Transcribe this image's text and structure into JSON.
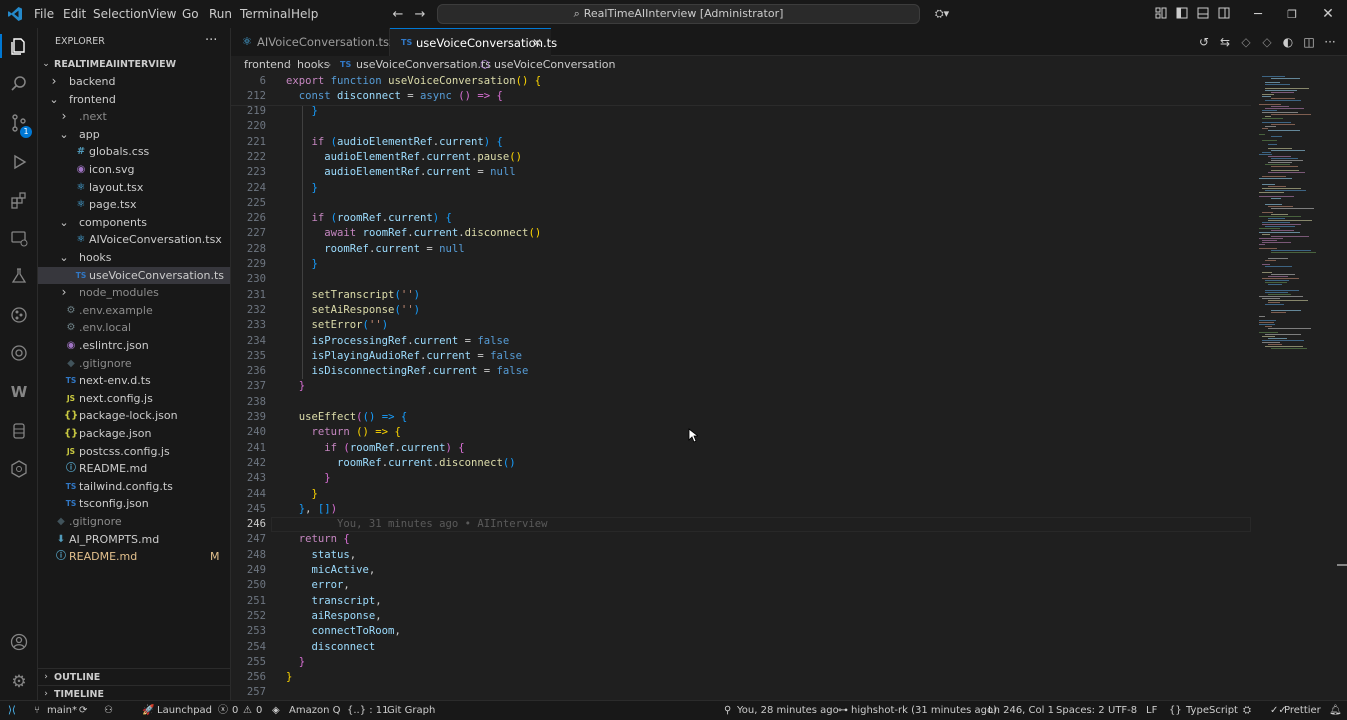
{
  "titlebar": {
    "menus": [
      "File",
      "Edit",
      "Selection",
      "View",
      "Go",
      "Run",
      "Terminal",
      "Help"
    ],
    "command_center": "RealTimeAIInterview [Administrator]"
  },
  "explorer": {
    "title": "EXPLORER",
    "root": "REALTIMEAIINTERVIEW",
    "items": [
      {
        "label": "backend",
        "kind": "folder",
        "open": false,
        "depth": 0
      },
      {
        "label": "frontend",
        "kind": "folder",
        "open": true,
        "depth": 0
      },
      {
        "label": ".next",
        "kind": "folder",
        "open": false,
        "depth": 1
      },
      {
        "label": "app",
        "kind": "folder",
        "open": true,
        "depth": 1
      },
      {
        "label": "globals.css",
        "kind": "file",
        "icon": "#",
        "depth": 2
      },
      {
        "label": "icon.svg",
        "kind": "file",
        "icon": "◉",
        "depth": 2
      },
      {
        "label": "layout.tsx",
        "kind": "file",
        "icon": "⚛",
        "depth": 2
      },
      {
        "label": "page.tsx",
        "kind": "file",
        "icon": "⚛",
        "depth": 2
      },
      {
        "label": "components",
        "kind": "folder",
        "open": true,
        "depth": 1
      },
      {
        "label": "AIVoiceConversation.tsx",
        "kind": "file",
        "icon": "⚛",
        "depth": 2
      },
      {
        "label": "hooks",
        "kind": "folder",
        "open": true,
        "depth": 1
      },
      {
        "label": "useVoiceConversation.ts",
        "kind": "file",
        "icon": "TS",
        "depth": 2,
        "selected": true
      },
      {
        "label": "node_modules",
        "kind": "folder",
        "open": false,
        "depth": 1
      },
      {
        "label": ".env.example",
        "kind": "file",
        "icon": "⚙",
        "depth": 1
      },
      {
        "label": ".env.local",
        "kind": "file",
        "icon": "⚙",
        "depth": 1
      },
      {
        "label": ".eslintrc.json",
        "kind": "file",
        "icon": "◉",
        "depth": 1
      },
      {
        "label": ".gitignore",
        "kind": "file",
        "icon": "◆",
        "depth": 1
      },
      {
        "label": "next-env.d.ts",
        "kind": "file",
        "icon": "TS",
        "depth": 1
      },
      {
        "label": "next.config.js",
        "kind": "file",
        "icon": "JS",
        "depth": 1
      },
      {
        "label": "package-lock.json",
        "kind": "file",
        "icon": "{}",
        "depth": 1
      },
      {
        "label": "package.json",
        "kind": "file",
        "icon": "{}",
        "depth": 1
      },
      {
        "label": "postcss.config.js",
        "kind": "file",
        "icon": "JS",
        "depth": 1
      },
      {
        "label": "README.md",
        "kind": "file",
        "icon": "ⓘ",
        "depth": 1
      },
      {
        "label": "tailwind.config.ts",
        "kind": "file",
        "icon": "TS",
        "depth": 1
      },
      {
        "label": "tsconfig.json",
        "kind": "file",
        "icon": "TS",
        "depth": 1
      },
      {
        "label": ".gitignore",
        "kind": "file",
        "icon": "◆",
        "depth": 0
      },
      {
        "label": "AI_PROMPTS.md",
        "kind": "file",
        "icon": "⬇",
        "depth": 0
      },
      {
        "label": "README.md",
        "kind": "file",
        "icon": "ⓘ",
        "depth": 0,
        "badge": "M"
      }
    ],
    "outline": "OUTLINE",
    "timeline": "TIMELINE"
  },
  "tabs": [
    {
      "label": "AIVoiceConversation.tsx",
      "icon": "⚛",
      "active": false
    },
    {
      "label": "useVoiceConversation.ts",
      "icon": "TS",
      "active": true
    }
  ],
  "breadcrumb": [
    "frontend",
    "hooks",
    "useVoiceConversation.ts",
    "useVoiceConversation"
  ],
  "sticky": [
    {
      "n": "6",
      "tokens": [
        [
          "export ",
          "kw2"
        ],
        [
          "function ",
          "kw"
        ],
        [
          "useVoiceConversation",
          "fn"
        ],
        [
          "() ",
          "br1"
        ],
        [
          "{",
          "br1"
        ]
      ]
    },
    {
      "n": "212",
      "tokens": [
        [
          "  ",
          ""
        ],
        [
          "const ",
          "kw"
        ],
        [
          "disconnect",
          "vr"
        ],
        [
          " = ",
          ""
        ],
        [
          "async ",
          "kw"
        ],
        [
          "() => ",
          "br2"
        ],
        [
          "{",
          "br2"
        ]
      ]
    }
  ],
  "lines": [
    {
      "n": "219",
      "tokens": [
        [
          "    ",
          ""
        ],
        [
          "}",
          "br3"
        ]
      ]
    },
    {
      "n": "220",
      "tokens": []
    },
    {
      "n": "221",
      "tokens": [
        [
          "    ",
          ""
        ],
        [
          "if ",
          "kw2"
        ],
        [
          "(",
          "br3"
        ],
        [
          "audioElementRef",
          "vr"
        ],
        [
          ".",
          ""
        ],
        [
          "current",
          "vr"
        ],
        [
          ") ",
          "br3"
        ],
        [
          "{",
          "br3"
        ]
      ]
    },
    {
      "n": "222",
      "tokens": [
        [
          "      ",
          ""
        ],
        [
          "audioElementRef",
          "vr"
        ],
        [
          ".",
          ""
        ],
        [
          "current",
          "vr"
        ],
        [
          ".",
          ""
        ],
        [
          "pause",
          "fn"
        ],
        [
          "()",
          "br1"
        ]
      ]
    },
    {
      "n": "223",
      "tokens": [
        [
          "      ",
          ""
        ],
        [
          "audioElementRef",
          "vr"
        ],
        [
          ".",
          ""
        ],
        [
          "current",
          "vr"
        ],
        [
          " = ",
          ""
        ],
        [
          "null",
          "kw"
        ]
      ]
    },
    {
      "n": "224",
      "tokens": [
        [
          "    ",
          ""
        ],
        [
          "}",
          "br3"
        ]
      ]
    },
    {
      "n": "225",
      "tokens": []
    },
    {
      "n": "226",
      "tokens": [
        [
          "    ",
          ""
        ],
        [
          "if ",
          "kw2"
        ],
        [
          "(",
          "br3"
        ],
        [
          "roomRef",
          "vr"
        ],
        [
          ".",
          ""
        ],
        [
          "current",
          "vr"
        ],
        [
          ") ",
          "br3"
        ],
        [
          "{",
          "br3"
        ]
      ]
    },
    {
      "n": "227",
      "tokens": [
        [
          "      ",
          ""
        ],
        [
          "await ",
          "kw2"
        ],
        [
          "roomRef",
          "vr"
        ],
        [
          ".",
          ""
        ],
        [
          "current",
          "vr"
        ],
        [
          ".",
          ""
        ],
        [
          "disconnect",
          "fn"
        ],
        [
          "()",
          "br1"
        ]
      ]
    },
    {
      "n": "228",
      "tokens": [
        [
          "      ",
          ""
        ],
        [
          "roomRef",
          "vr"
        ],
        [
          ".",
          ""
        ],
        [
          "current",
          "vr"
        ],
        [
          " = ",
          ""
        ],
        [
          "null",
          "kw"
        ]
      ]
    },
    {
      "n": "229",
      "tokens": [
        [
          "    ",
          ""
        ],
        [
          "}",
          "br3"
        ]
      ]
    },
    {
      "n": "230",
      "tokens": []
    },
    {
      "n": "231",
      "tokens": [
        [
          "    ",
          ""
        ],
        [
          "setTranscript",
          "fn"
        ],
        [
          "(",
          "br3"
        ],
        [
          "''",
          "st"
        ],
        [
          ")",
          "br3"
        ]
      ]
    },
    {
      "n": "232",
      "tokens": [
        [
          "    ",
          ""
        ],
        [
          "setAiResponse",
          "fn"
        ],
        [
          "(",
          "br3"
        ],
        [
          "''",
          "st"
        ],
        [
          ")",
          "br3"
        ]
      ]
    },
    {
      "n": "233",
      "tokens": [
        [
          "    ",
          ""
        ],
        [
          "setError",
          "fn"
        ],
        [
          "(",
          "br3"
        ],
        [
          "''",
          "st"
        ],
        [
          ")",
          "br3"
        ]
      ]
    },
    {
      "n": "234",
      "tokens": [
        [
          "    ",
          ""
        ],
        [
          "isProcessingRef",
          "vr"
        ],
        [
          ".",
          ""
        ],
        [
          "current",
          "vr"
        ],
        [
          " = ",
          ""
        ],
        [
          "false",
          "kw"
        ]
      ]
    },
    {
      "n": "235",
      "tokens": [
        [
          "    ",
          ""
        ],
        [
          "isPlayingAudioRef",
          "vr"
        ],
        [
          ".",
          ""
        ],
        [
          "current",
          "vr"
        ],
        [
          " = ",
          ""
        ],
        [
          "false",
          "kw"
        ]
      ]
    },
    {
      "n": "236",
      "tokens": [
        [
          "    ",
          ""
        ],
        [
          "isDisconnectingRef",
          "vr"
        ],
        [
          ".",
          ""
        ],
        [
          "current",
          "vr"
        ],
        [
          " = ",
          ""
        ],
        [
          "false",
          "kw"
        ]
      ]
    },
    {
      "n": "237",
      "tokens": [
        [
          "  ",
          ""
        ],
        [
          "}",
          "br2"
        ]
      ]
    },
    {
      "n": "238",
      "tokens": []
    },
    {
      "n": "239",
      "tokens": [
        [
          "  ",
          ""
        ],
        [
          "useEffect",
          "fn"
        ],
        [
          "(",
          "br2"
        ],
        [
          "() => ",
          "br3"
        ],
        [
          "{",
          "br3"
        ]
      ]
    },
    {
      "n": "240",
      "tokens": [
        [
          "    ",
          ""
        ],
        [
          "return ",
          "kw2"
        ],
        [
          "() => ",
          "br1"
        ],
        [
          "{",
          "br1"
        ]
      ]
    },
    {
      "n": "241",
      "tokens": [
        [
          "      ",
          ""
        ],
        [
          "if ",
          "kw2"
        ],
        [
          "(",
          "br2"
        ],
        [
          "roomRef",
          "vr"
        ],
        [
          ".",
          ""
        ],
        [
          "current",
          "vr"
        ],
        [
          ") ",
          "br2"
        ],
        [
          "{",
          "br2"
        ]
      ]
    },
    {
      "n": "242",
      "tokens": [
        [
          "        ",
          ""
        ],
        [
          "roomRef",
          "vr"
        ],
        [
          ".",
          ""
        ],
        [
          "current",
          "vr"
        ],
        [
          ".",
          ""
        ],
        [
          "disconnect",
          "fn"
        ],
        [
          "()",
          "br3"
        ]
      ]
    },
    {
      "n": "243",
      "tokens": [
        [
          "      ",
          ""
        ],
        [
          "}",
          "br2"
        ]
      ]
    },
    {
      "n": "244",
      "tokens": [
        [
          "    ",
          ""
        ],
        [
          "}",
          "br1"
        ]
      ]
    },
    {
      "n": "245",
      "tokens": [
        [
          "  ",
          ""
        ],
        [
          "}",
          "br3"
        ],
        [
          ", ",
          ""
        ],
        [
          "[]",
          "br3"
        ],
        [
          ")",
          "br2"
        ]
      ]
    },
    {
      "n": "246",
      "tokens": [
        [
          "        ",
          ""
        ],
        [
          "You, 31 minutes ago • AIInterview",
          "dim"
        ]
      ],
      "current": true
    },
    {
      "n": "247",
      "tokens": [
        [
          "  ",
          ""
        ],
        [
          "return ",
          "kw2"
        ],
        [
          "{",
          "br2"
        ]
      ]
    },
    {
      "n": "248",
      "tokens": [
        [
          "    ",
          ""
        ],
        [
          "status",
          "vr"
        ],
        [
          ",",
          ""
        ]
      ]
    },
    {
      "n": "249",
      "tokens": [
        [
          "    ",
          ""
        ],
        [
          "micActive",
          "vr"
        ],
        [
          ",",
          ""
        ]
      ]
    },
    {
      "n": "250",
      "tokens": [
        [
          "    ",
          ""
        ],
        [
          "error",
          "vr"
        ],
        [
          ",",
          ""
        ]
      ]
    },
    {
      "n": "251",
      "tokens": [
        [
          "    ",
          ""
        ],
        [
          "transcript",
          "vr"
        ],
        [
          ",",
          ""
        ]
      ]
    },
    {
      "n": "252",
      "tokens": [
        [
          "    ",
          ""
        ],
        [
          "aiResponse",
          "vr"
        ],
        [
          ",",
          ""
        ]
      ]
    },
    {
      "n": "253",
      "tokens": [
        [
          "    ",
          ""
        ],
        [
          "connectToRoom",
          "vr"
        ],
        [
          ",",
          ""
        ]
      ]
    },
    {
      "n": "254",
      "tokens": [
        [
          "    ",
          ""
        ],
        [
          "disconnect",
          "vr"
        ]
      ]
    },
    {
      "n": "255",
      "tokens": [
        [
          "  ",
          ""
        ],
        [
          "}",
          "br2"
        ]
      ]
    },
    {
      "n": "256",
      "tokens": [
        [
          "}",
          "br1"
        ]
      ]
    },
    {
      "n": "257",
      "tokens": []
    }
  ],
  "statusbar": {
    "branch": "main*",
    "launchpad": "Launchpad",
    "errors": "0",
    "warnings": "0",
    "amazon_q": "Amazon Q",
    "selection": "{..} : 11",
    "git_graph": "Git Graph",
    "blame": "You, 28 minutes ago",
    "commit": "highshot-rk (31 minutes ago)",
    "position": "Ln 246, Col 1",
    "spaces": "Spaces: 2",
    "encoding": "UTF-8",
    "eol": "LF",
    "language": "TypeScript",
    "prettier": "Prettier"
  },
  "colors": {
    "accent": "#0078d4",
    "badge": "#0078d4",
    "modified": "#e2c08d"
  }
}
